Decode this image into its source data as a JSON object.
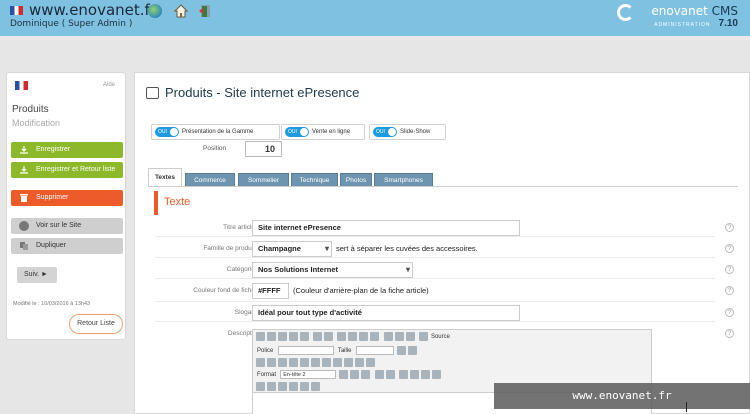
{
  "header": {
    "site_url": "www.enovanet.fr",
    "user": "Dominique ( Super Admin )",
    "brand_name_1": "enovanet",
    "brand_cms": "CMS",
    "brand_sub": "ADMINISTRATION",
    "version": "7.10",
    "colors": {
      "bar": "#7fc1e0",
      "brand_dark": "#1b3954"
    }
  },
  "sidebar": {
    "aide": "Aide",
    "title": "Produits",
    "subtitle": "Modification",
    "buttons": {
      "save": "Enregistrer",
      "save_return": "Enregistrer et Retour liste",
      "delete": "Supprimer",
      "view_site": "Voir sur le Site",
      "duplicate": "Dupliquer"
    },
    "next": "Suiv. ►",
    "modified": "Modifié le : 10/03/2016 à 13h43",
    "back_list": "Retour Liste"
  },
  "main": {
    "title": "Produits - Site internet ePresence",
    "toggles": [
      {
        "state": "OUI",
        "label": "Présentation de la Gamme"
      },
      {
        "state": "OUI",
        "label": "Vente en ligne"
      },
      {
        "state": "OUI",
        "label": "Slide-Show"
      }
    ],
    "position_label": "Position",
    "position_value": "10",
    "tabs": [
      "Textes",
      "Commerce",
      "Sommelier",
      "Technique",
      "Photos",
      "Smartphones"
    ],
    "section_title": "Texte",
    "fields": {
      "titre_label": "Titre article",
      "titre_value": "Site internet ePresence",
      "famille_label": "Famille de produit",
      "famille_value": "Champagne",
      "famille_note": "sert à séparer les cuvées des accessoires.",
      "categorie_label": "Catégorie",
      "categorie_value": "Nos Solutions Internet",
      "couleur_label": "Couleur fond de fiche",
      "couleur_value": "#FFFF",
      "couleur_note": "(Couleur d'arrière-plan de la fiche article)",
      "slogan_label": "Slogan",
      "slogan_value": "Idéal pour tout type d'activité",
      "descriptif_label": "Descriptif"
    },
    "editor": {
      "source": "Source",
      "police": "Police",
      "taille": "Taille",
      "format": "Format",
      "format_value": "En-tête 2"
    },
    "help": "?"
  },
  "watermark": "www.enovanet.fr"
}
